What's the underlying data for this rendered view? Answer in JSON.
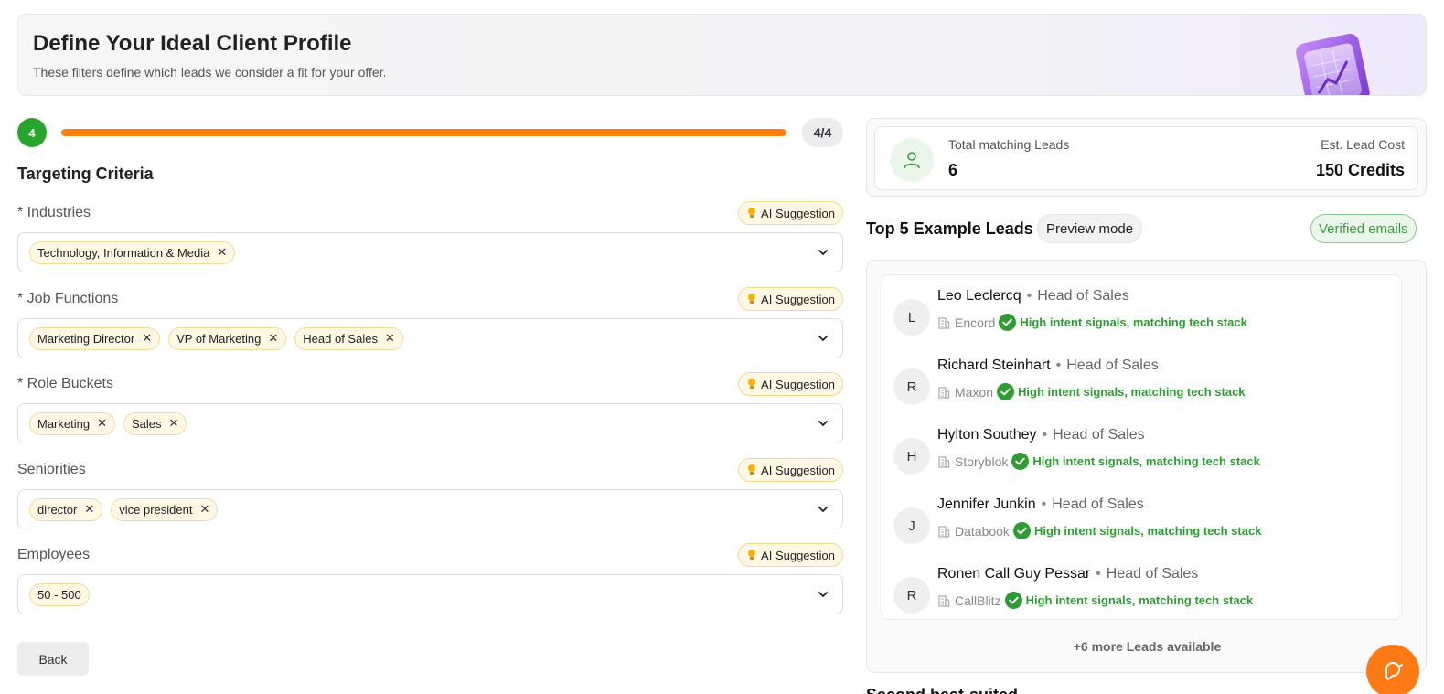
{
  "header": {
    "title": "Define Your Ideal Client Profile",
    "subtitle": "These filters define which leads we consider a fit for your offer."
  },
  "progress": {
    "step": "4",
    "count_label": "4/4",
    "fraction": 1.0,
    "color": "#ff7f0e"
  },
  "section_title": "Targeting Criteria",
  "ai_label": "AI Suggestion",
  "fields": [
    {
      "label": "* Industries",
      "chips": [
        "Technology, Information & Media"
      ]
    },
    {
      "label": "* Job Functions",
      "chips": [
        "Marketing Director",
        "VP of Marketing",
        "Head of Sales"
      ]
    },
    {
      "label": "* Role Buckets",
      "chips": [
        "Marketing",
        "Sales"
      ]
    },
    {
      "label": "Seniorities",
      "chips": [
        "director",
        "vice president"
      ]
    },
    {
      "label": "Employees",
      "chips": [
        "50 - 500"
      ]
    }
  ],
  "back_label": "Back",
  "stats": {
    "leads_label": "Total matching Leads",
    "leads_value": "6",
    "cost_label": "Est. Lead Cost",
    "cost_value": "150 Credits"
  },
  "leads_section": {
    "title": "Top 5 Example Leads",
    "preview_label": "Preview mode",
    "verified_label": "Verified emails",
    "more_label": "+6 more Leads available",
    "leads": [
      {
        "initial": "L",
        "name": "Leo Leclercq",
        "role": "Head of Sales",
        "company": "Encord",
        "signal": "High intent signals, matching tech stack"
      },
      {
        "initial": "R",
        "name": "Richard Steinhart",
        "role": "Head of Sales",
        "company": "Maxon",
        "signal": "High intent signals, matching tech stack"
      },
      {
        "initial": "H",
        "name": "Hylton Southey",
        "role": "Head of Sales",
        "company": "Storyblok",
        "signal": "High intent signals, matching tech stack"
      },
      {
        "initial": "J",
        "name": "Jennifer Junkin",
        "role": "Head of Sales",
        "company": "Databook",
        "signal": "High intent signals, matching tech stack"
      },
      {
        "initial": "R",
        "name": "Ronen Call Guy Pessar",
        "role": "Head of Sales",
        "company": "CallBlitz",
        "signal": "High intent signals, matching tech stack"
      }
    ]
  },
  "cut_heading": "Second best-suited",
  "icons": {
    "step": "progress-step-icon",
    "bulb": "lightbulb-icon",
    "chevron": "chevron-down-icon",
    "remove": "close-icon",
    "user": "user-icon",
    "building": "building-icon",
    "check": "check-circle-icon",
    "chat": "chat-support-icon"
  },
  "colors": {
    "accent_orange": "#ff7f0e",
    "success_green": "#27a52c",
    "chip_bg": "#fff8e5"
  }
}
